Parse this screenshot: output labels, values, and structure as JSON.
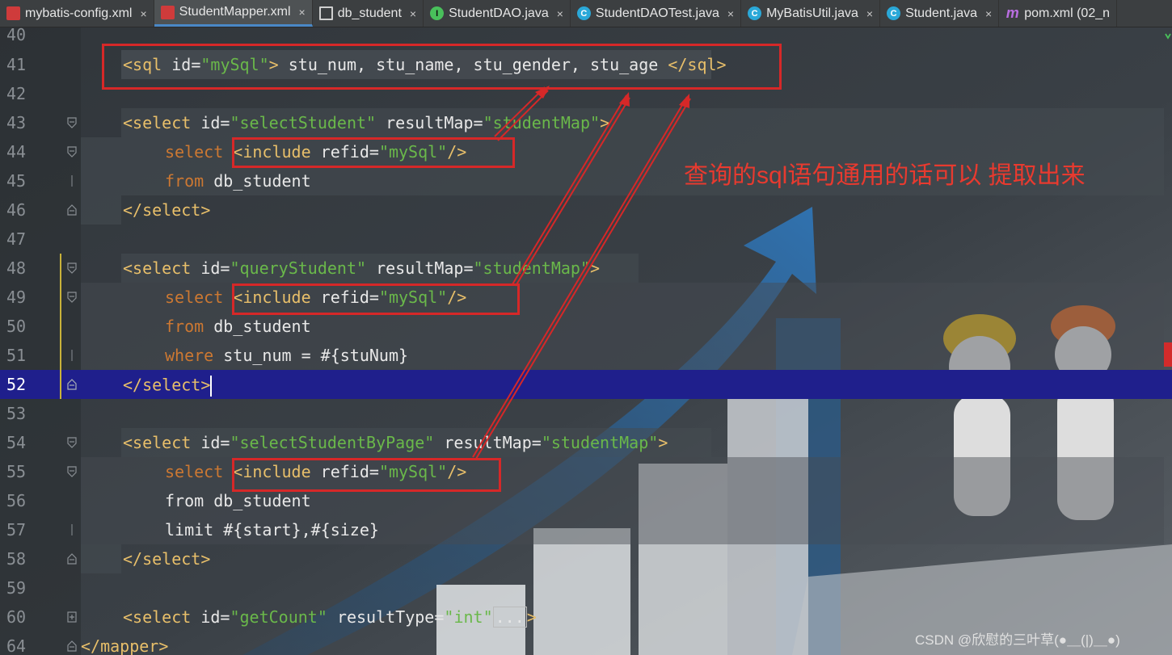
{
  "tabs": [
    {
      "label": "mybatis-config.xml",
      "icon": "xml-file-icon",
      "active": false
    },
    {
      "label": "StudentMapper.xml",
      "icon": "xml-file-icon",
      "active": true
    },
    {
      "label": "db_student",
      "icon": "table-icon",
      "active": false
    },
    {
      "label": "StudentDAO.java",
      "icon": "interface-icon",
      "active": false
    },
    {
      "label": "StudentDAOTest.java",
      "icon": "class-icon",
      "active": false
    },
    {
      "label": "MyBatisUtil.java",
      "icon": "class-icon",
      "active": false
    },
    {
      "label": "Student.java",
      "icon": "class-icon",
      "active": false
    },
    {
      "label": "pom.xml (02_n",
      "icon": "maven-icon",
      "active": false
    }
  ],
  "tab_close_glyph": "×",
  "tab_icon_letters": {
    "interface": "I",
    "class": "C",
    "maven": "m"
  },
  "lines": {
    "l40": "40",
    "l41": "41",
    "l42": "42",
    "l43": "43",
    "l44": "44",
    "l45": "45",
    "l46": "46",
    "l47": "47",
    "l48": "48",
    "l49": "49",
    "l50": "50",
    "l51": "51",
    "l52": "52",
    "l53": "53",
    "l54": "54",
    "l55": "55",
    "l56": "56",
    "l57": "57",
    "l58": "58",
    "l59": "59",
    "l60": "60",
    "l64": "64"
  },
  "code": {
    "sql_open": "<sql ",
    "id_attr": "id",
    "eq": "=",
    "mysql_val": "\"mySql\"",
    "gt": ">",
    "sql_columns": " stu_num, stu_name, stu_gender, stu_age ",
    "sql_close": "</sql>",
    "select_open": "<select ",
    "resultmap_attr": "resultMap",
    "resulttype_attr": "resultType",
    "studentmap_val": "\"studentMap\"",
    "select_student_val": "\"selectStudent\"",
    "query_student_val": "\"queryStudent\"",
    "select_by_page_val": "\"selectStudentByPage\"",
    "get_count_val": "\"getCount\"",
    "int_val": "\"int\"",
    "kw_select": "select ",
    "include_open": "<include ",
    "refid_attr": "refid",
    "selfclose": "/>",
    "kw_from": "from",
    "db_student": " db_student",
    "kw_where": "where",
    "where_rest": " stu_num = #{stuNum}",
    "kw_limit": "limit",
    "limit_rest": " #{start},#{size}",
    "select_close": "</select>",
    "collapsed": "...",
    "mapper_close": "</mapper>"
  },
  "annotation": "查询的sql语句通用的话可以 提取出来",
  "watermark": "CSDN @欣慰的三叶草(●＿(|)＿●)",
  "colors": {
    "annotation_red": "#e83a2f",
    "current_line": "#1f1f8c",
    "tag": "#e8bf6a",
    "value": "#6ab84a",
    "keyword": "#cc7832"
  }
}
